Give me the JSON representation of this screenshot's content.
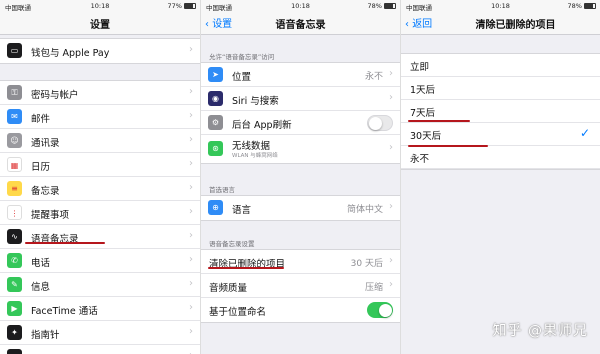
{
  "status_bar": {
    "carrier": "中国联通",
    "time": "10:18",
    "battery_p1": "77%",
    "battery_p2": "78%",
    "battery_p3": "78%"
  },
  "panel1": {
    "title": "设置",
    "wallet_label": "钱包与 Apple Pay",
    "items": [
      {
        "label": "密码与帐户",
        "icon": "key-icon",
        "color": "#8e8e93"
      },
      {
        "label": "邮件",
        "icon": "mail-icon",
        "color": "#2f8cf6"
      },
      {
        "label": "通讯录",
        "icon": "contacts-icon",
        "color": "#9a9a9f"
      },
      {
        "label": "日历",
        "icon": "calendar-icon",
        "color": "#ffffff"
      },
      {
        "label": "备忘录",
        "icon": "notes-icon",
        "color": "#ffd94a"
      },
      {
        "label": "提醒事项",
        "icon": "reminders-icon",
        "color": "#ffffff"
      },
      {
        "label": "语音备忘录",
        "icon": "voice-memos-icon",
        "color": "#1c1c1e"
      },
      {
        "label": "电话",
        "icon": "phone-icon",
        "color": "#34c759"
      },
      {
        "label": "信息",
        "icon": "messages-icon",
        "color": "#34c759"
      },
      {
        "label": "FaceTime 通话",
        "icon": "facetime-icon",
        "color": "#34c759"
      },
      {
        "label": "指南针",
        "icon": "compass-icon",
        "color": "#1c1c1e"
      },
      {
        "label": "测距仪",
        "icon": "measure-icon",
        "color": "#1c1c1e"
      }
    ]
  },
  "panel2": {
    "back": "设置",
    "title": "语音备忘录",
    "allow_header": "允许“语音备忘录”访问",
    "location": {
      "label": "位置",
      "value": "永不"
    },
    "siri_label": "Siri 与搜索",
    "background_refresh_label": "后台 App刷新",
    "wireless": {
      "label": "无线数据",
      "sub": "WLAN 与蜂窝网络"
    },
    "pref_lang_header": "首选语言",
    "language": {
      "label": "语言",
      "value": "简体中文"
    },
    "settings_header": "语音备忘录设置",
    "clear_deleted": {
      "label": "清除已删除的项目",
      "value": "30 天后"
    },
    "audio_quality": {
      "label": "音频质量",
      "value": "压缩"
    },
    "location_naming_label": "基于位置命名"
  },
  "panel3": {
    "back": "返回",
    "title": "清除已删除的项目",
    "options": [
      "立即",
      "1天后",
      "7天后",
      "30天后",
      "永不"
    ],
    "selected_index": 3
  },
  "watermark": "知乎 @果师兄"
}
